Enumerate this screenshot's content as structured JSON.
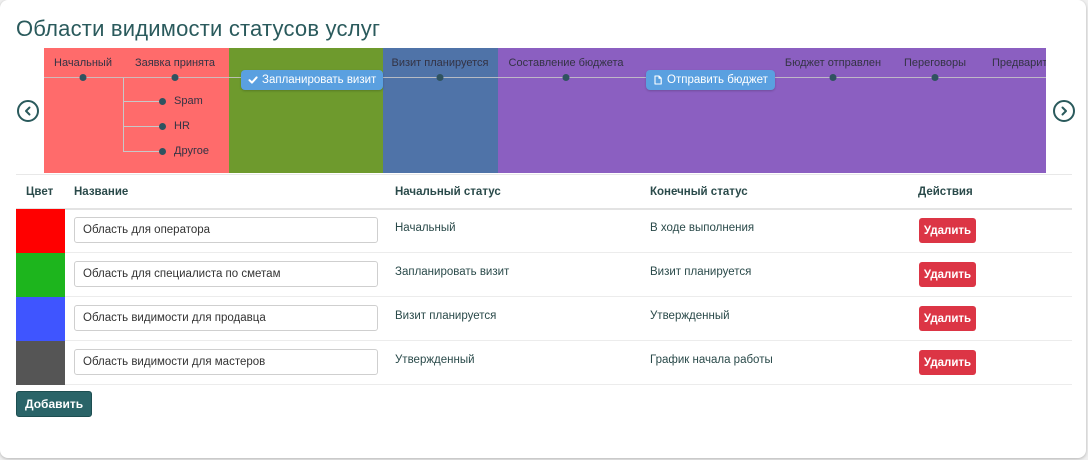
{
  "page": {
    "title": "Области видимости статусов услуг"
  },
  "timeline": {
    "statuses": [
      "Начальный",
      "Заявка принята",
      "Визит планируется",
      "Составление бюджета",
      "Бюджет отправлен",
      "Переговоры",
      "Предварите"
    ],
    "branches": [
      "Spam",
      "HR",
      "Другое"
    ],
    "tags": {
      "schedule_visit": "Запланировать визит",
      "send_budget": "Отправить бюджет"
    },
    "zone_colors": [
      "#ff6b6b",
      "#6e9a2d",
      "#4f73a8",
      "#8b5fc1"
    ]
  },
  "table": {
    "headers": {
      "color": "Цвет",
      "name": "Название",
      "start_status": "Начальный статус",
      "end_status": "Конечный статус",
      "actions": "Действия"
    },
    "rows": [
      {
        "color": "#ff0000",
        "name": "Область для оператора",
        "start": "Начальный",
        "end": "В ходе выполнения",
        "delete": "Удалить"
      },
      {
        "color": "#1db51d",
        "name": "Область для специалиста по сметам",
        "start": "Запланировать визит",
        "end": "Визит планируется",
        "delete": "Удалить"
      },
      {
        "color": "#3f55ff",
        "name": "Область видимости для продавца",
        "start": "Визит планируется",
        "end": "Утвержденный",
        "delete": "Удалить"
      },
      {
        "color": "#555555",
        "name": "Область видимости для мастеров",
        "start": "Утвержденный",
        "end": "График начала работы",
        "delete": "Удалить"
      }
    ]
  },
  "add_button": "Добавить",
  "icons": {
    "prev": "chevron-left-icon",
    "next": "chevron-right-icon",
    "check": "check-icon",
    "document": "document-icon"
  }
}
